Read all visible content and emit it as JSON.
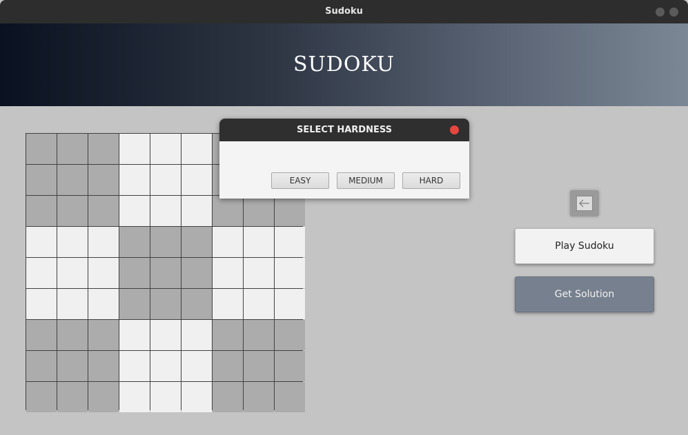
{
  "window": {
    "title": "Sudoku"
  },
  "header": {
    "heading": "SUDOKU"
  },
  "board": {
    "rows": 9,
    "cols": 9,
    "box_shading": [
      [
        "dark",
        "light",
        "dark"
      ],
      [
        "light",
        "dark",
        "light"
      ],
      [
        "dark",
        "light",
        "dark"
      ]
    ],
    "colors": {
      "dark": "#acacac",
      "light": "#f0f0f0",
      "grid": "#404040"
    }
  },
  "dialog": {
    "title": "SELECT HARDNESS",
    "buttons": [
      "EASY",
      "MEDIUM",
      "HARD"
    ]
  },
  "sidebar": {
    "back_icon": "left-arrow-icon",
    "play_label": "Play Sudoku",
    "solution_label": "Get Solution"
  },
  "colors": {
    "close_button": "#e5473f",
    "solution_button": "#76808e"
  }
}
